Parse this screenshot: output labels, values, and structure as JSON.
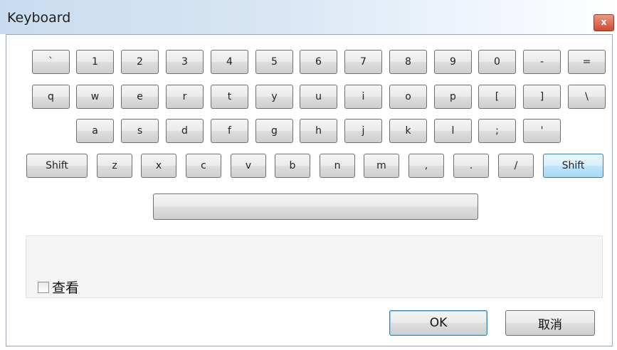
{
  "window": {
    "title": "Keyboard",
    "close_label": "x"
  },
  "keyboard": {
    "rows": [
      [
        "`",
        "1",
        "2",
        "3",
        "4",
        "5",
        "6",
        "7",
        "8",
        "9",
        "0",
        "-",
        "="
      ],
      [
        "q",
        "w",
        "e",
        "r",
        "t",
        "y",
        "u",
        "i",
        "o",
        "p",
        "[",
        "]",
        "\\"
      ],
      [
        "a",
        "s",
        "d",
        "f",
        "g",
        "h",
        "j",
        "k",
        "l",
        ";",
        "'"
      ],
      [
        "Shift",
        "z",
        "x",
        "c",
        "v",
        "b",
        "n",
        "m",
        ",",
        ".",
        "/",
        "Shift"
      ]
    ],
    "space_label": ""
  },
  "checkbox": {
    "label": "查看",
    "checked": false
  },
  "buttons": {
    "ok": "OK",
    "cancel": "取消"
  }
}
